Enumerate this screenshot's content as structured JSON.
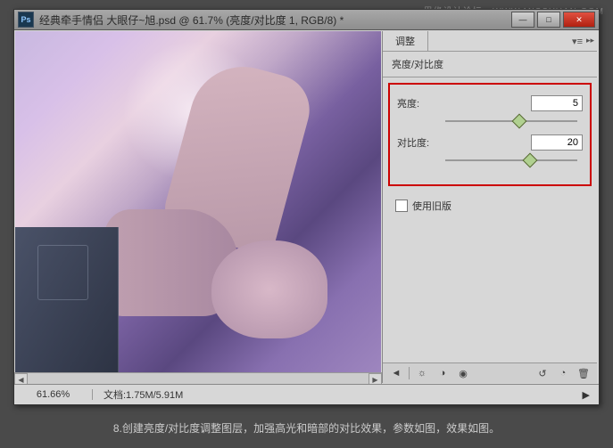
{
  "watermark": "思缘设计论坛 . WWW.MISSYUAN.COM",
  "titlebar": {
    "ps": "Ps",
    "title": "经典牵手情侣   大眼仔~旭.psd @ 61.7% (亮度/对比度 1, RGB/8) *"
  },
  "winbtns": {
    "min": "—",
    "max": "□",
    "close": "✕"
  },
  "panel": {
    "tab": "调整",
    "header": "亮度/对比度",
    "brightness": {
      "label": "亮度:",
      "value": "5"
    },
    "contrast": {
      "label": "对比度:",
      "value": "20"
    },
    "legacy": "使用旧版"
  },
  "foot": {
    "i1": "◄",
    "i2": "☼",
    "i3": "◑",
    "i4": "◉",
    "i5": "↺",
    "i6": "◔",
    "i7": "🗑"
  },
  "status": {
    "zoom": "61.66%",
    "doc": "文档:1.75M/5.91M",
    "play": "▶"
  },
  "scroll": {
    "l": "◀",
    "r": "▶"
  },
  "caption": "8.创建亮度/对比度调整图层，加强高光和暗部的对比效果，参数如图，效果如图。"
}
